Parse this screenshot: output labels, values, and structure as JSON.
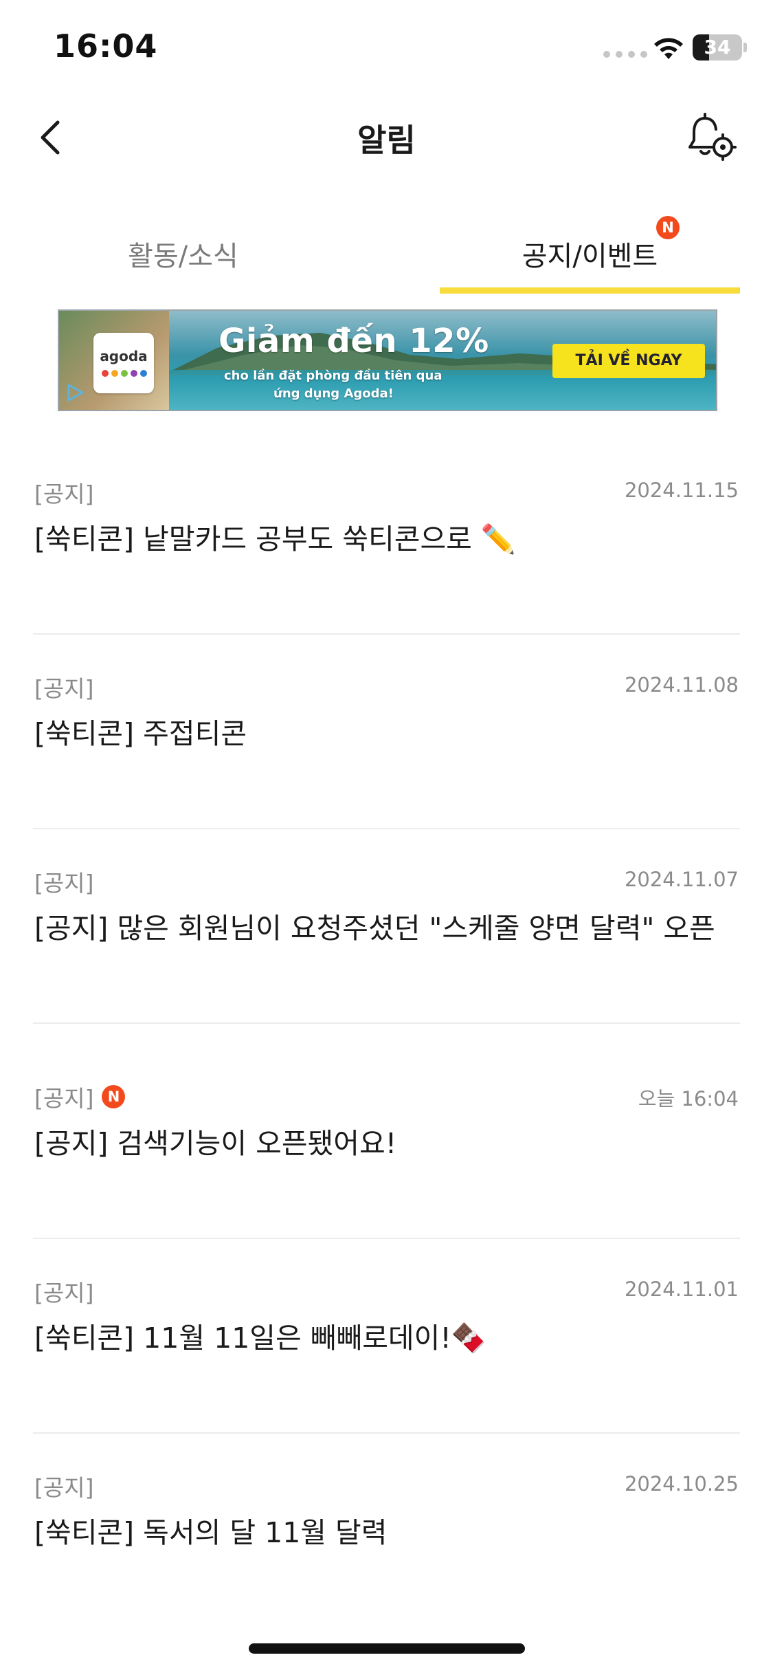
{
  "status_bar": {
    "time": "16:04",
    "battery": "34",
    "battery_level": 0.34
  },
  "header": {
    "title": "알림"
  },
  "tabs": [
    {
      "label": "활동/소식",
      "active": false
    },
    {
      "label": "공지/이벤트",
      "active": true,
      "badge": "N"
    }
  ],
  "banner": {
    "brand": "agoda",
    "headline": "Giảm đến 12%",
    "subline1": "cho lần đặt phòng đầu tiên qua",
    "subline2": "ứng dụng Agoda!",
    "cta": "TẢI VỀ NGAY"
  },
  "notices": [
    {
      "category": "[공지]",
      "date": "2024.11.15",
      "title": "[쑥티콘] 낱말카드 공부도 쑥티콘으로 ✏️",
      "is_new": false
    },
    {
      "category": "[공지]",
      "date": "2024.11.08",
      "title": "[쑥티콘] 주접티콘",
      "is_new": false
    },
    {
      "category": "[공지]",
      "date": "2024.11.07",
      "title": "[공지] 많은 회원님이 요청주셨던 \"스케줄 양면 달력\" 오픈",
      "is_new": false
    },
    {
      "category": "[공지]",
      "date": "오늘 16:04",
      "title": "[공지] 검색기능이 오픈됐어요!",
      "is_new": true,
      "badge": "N"
    },
    {
      "category": "[공지]",
      "date": "2024.11.01",
      "title": "[쑥티콘] 11월 11일은 빼빼로데이!🍫",
      "is_new": false
    },
    {
      "category": "[공지]",
      "date": "2024.10.25",
      "title": "[쑥티콘] 독서의 달 11월 달력",
      "is_new": false
    }
  ],
  "colors": {
    "accent_yellow": "#f7dc3c",
    "badge_red": "#f24a1d",
    "muted_text": "#8a8a8a",
    "divider": "#ececec"
  }
}
